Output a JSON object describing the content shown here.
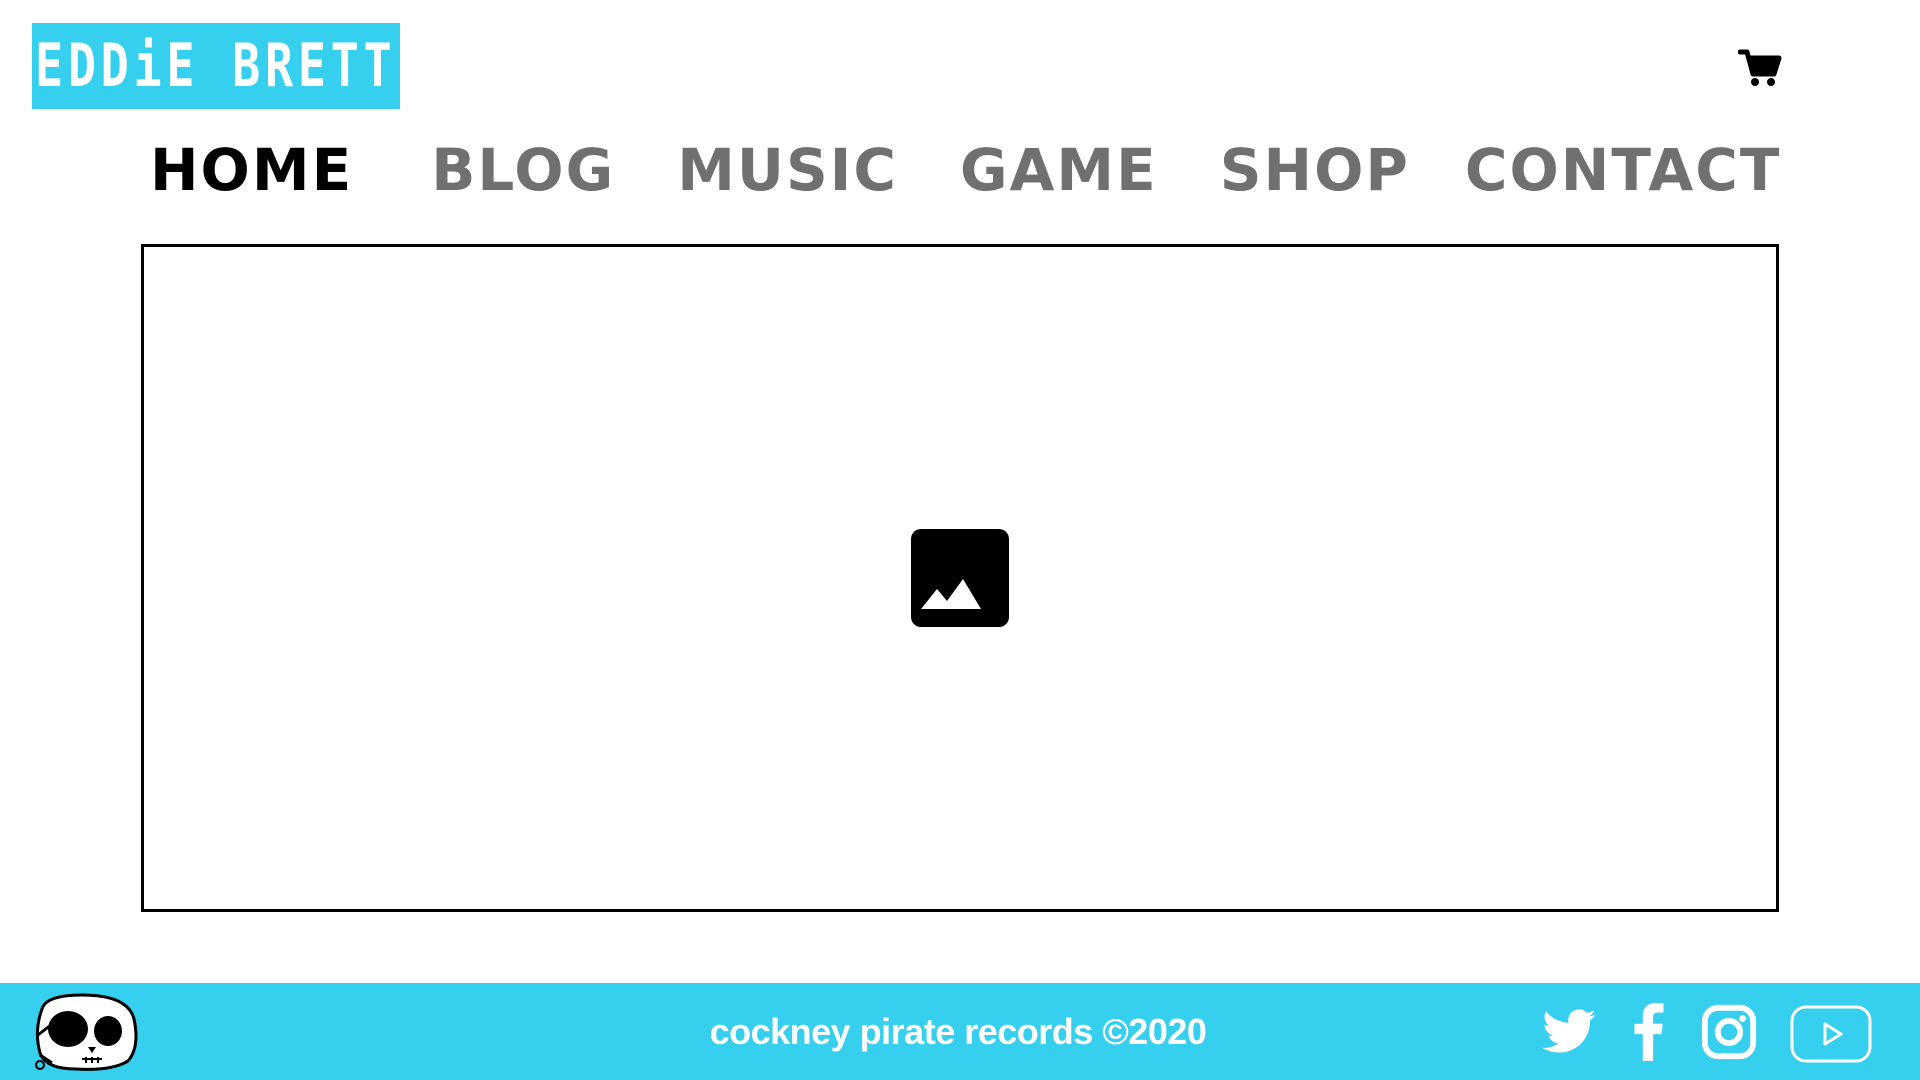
{
  "header": {
    "logo_text": "EDDiE BRETT",
    "cart_icon": "shopping-cart-icon"
  },
  "nav": {
    "items": [
      {
        "label": "HOME",
        "active": true
      },
      {
        "label": "BLOG",
        "active": false
      },
      {
        "label": "MUSIC",
        "active": false
      },
      {
        "label": "GAME",
        "active": false
      },
      {
        "label": "SHOP",
        "active": false
      },
      {
        "label": "CONTACT",
        "active": false
      }
    ]
  },
  "hero": {
    "placeholder_icon": "image-placeholder-icon"
  },
  "footer": {
    "mascot_icon": "pirate-skull-icon",
    "copyright": "cockney pirate records ©2020",
    "social": [
      "twitter-icon",
      "facebook-icon",
      "instagram-icon",
      "youtube-icon"
    ]
  },
  "colors": {
    "accent": "#36cfee",
    "nav_active": "#000000",
    "nav_inactive": "#707070",
    "footer_text": "#ffffff"
  }
}
